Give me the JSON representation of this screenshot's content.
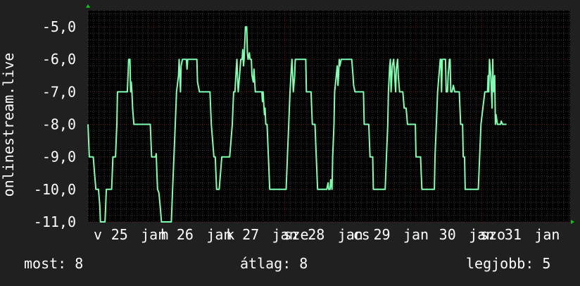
{
  "chart_data": {
    "type": "line",
    "ylabel": "onlinestream.live",
    "ylim": [
      -11,
      -4.5
    ],
    "yticks": [
      {
        "value": -5,
        "label": "-5,0"
      },
      {
        "value": -6,
        "label": "-6,0"
      },
      {
        "value": -7,
        "label": "-7,0"
      },
      {
        "value": -8,
        "label": "-8,0"
      },
      {
        "value": -9,
        "label": "-9,0"
      },
      {
        "value": -10,
        "label": "-10,0"
      },
      {
        "value": -11,
        "label": "-11,0"
      }
    ],
    "xlim": [
      0,
      7.35
    ],
    "xticks": [
      {
        "value": 0.15,
        "label": "v"
      },
      {
        "value": 0.48,
        "label": "25"
      },
      {
        "value": 1.0,
        "label": "jan"
      },
      {
        "value": 1.17,
        "label": "h"
      },
      {
        "value": 1.48,
        "label": "26"
      },
      {
        "value": 2.0,
        "label": "jan"
      },
      {
        "value": 2.17,
        "label": "k"
      },
      {
        "value": 2.48,
        "label": "27"
      },
      {
        "value": 3.0,
        "label": "jan"
      },
      {
        "value": 3.17,
        "label": "sze"
      },
      {
        "value": 3.48,
        "label": "28"
      },
      {
        "value": 4.0,
        "label": "jan"
      },
      {
        "value": 4.17,
        "label": "cs"
      },
      {
        "value": 4.48,
        "label": "29"
      },
      {
        "value": 5.0,
        "label": "jan"
      },
      {
        "value": 5.48,
        "label": "30"
      },
      {
        "value": 6.0,
        "label": "jan"
      },
      {
        "value": 6.17,
        "label": "szo"
      },
      {
        "value": 6.48,
        "label": "31"
      },
      {
        "value": 7.0,
        "label": "jan"
      }
    ],
    "grid": true,
    "series": [
      {
        "color": "#7fffb0",
        "points": [
          [
            0.0,
            -8
          ],
          [
            0.02,
            -9
          ],
          [
            0.08,
            -9
          ],
          [
            0.1,
            -9.5
          ],
          [
            0.12,
            -10
          ],
          [
            0.16,
            -10
          ],
          [
            0.18,
            -10.5
          ],
          [
            0.19,
            -11
          ],
          [
            0.26,
            -11
          ],
          [
            0.28,
            -10
          ],
          [
            0.36,
            -10
          ],
          [
            0.38,
            -9
          ],
          [
            0.42,
            -9
          ],
          [
            0.44,
            -8
          ],
          [
            0.45,
            -7
          ],
          [
            0.6,
            -7
          ],
          [
            0.61,
            -6.5
          ],
          [
            0.62,
            -6
          ],
          [
            0.64,
            -6
          ],
          [
            0.65,
            -7
          ],
          [
            0.66,
            -6.7
          ],
          [
            0.67,
            -7
          ],
          [
            0.68,
            -7.5
          ],
          [
            0.7,
            -8
          ],
          [
            0.95,
            -8
          ],
          [
            0.97,
            -9
          ],
          [
            1.03,
            -9
          ],
          [
            1.04,
            -8.9
          ],
          [
            1.05,
            -9.5
          ],
          [
            1.06,
            -10
          ],
          [
            1.08,
            -10.1
          ],
          [
            1.1,
            -10.5
          ],
          [
            1.12,
            -11
          ],
          [
            1.27,
            -11
          ],
          [
            1.29,
            -10
          ],
          [
            1.31,
            -9
          ],
          [
            1.33,
            -8
          ],
          [
            1.35,
            -7
          ],
          [
            1.38,
            -6.5
          ],
          [
            1.39,
            -6
          ],
          [
            1.41,
            -7
          ],
          [
            1.42,
            -6.2
          ],
          [
            1.44,
            -6
          ],
          [
            1.5,
            -6
          ],
          [
            1.51,
            -6.3
          ],
          [
            1.52,
            -6
          ],
          [
            1.66,
            -6
          ],
          [
            1.67,
            -6.7
          ],
          [
            1.7,
            -7
          ],
          [
            1.86,
            -7
          ],
          [
            1.88,
            -8
          ],
          [
            1.92,
            -9
          ],
          [
            1.94,
            -9
          ],
          [
            1.96,
            -10
          ],
          [
            2.0,
            -10
          ],
          [
            2.02,
            -9.5
          ],
          [
            2.04,
            -9
          ],
          [
            2.16,
            -9
          ],
          [
            2.18,
            -8.5
          ],
          [
            2.2,
            -8
          ],
          [
            2.22,
            -7
          ],
          [
            2.24,
            -7
          ],
          [
            2.26,
            -6.3
          ],
          [
            2.27,
            -6
          ],
          [
            2.28,
            -6.6
          ],
          [
            2.29,
            -7
          ],
          [
            2.31,
            -6.5
          ],
          [
            2.33,
            -6
          ],
          [
            2.35,
            -6
          ],
          [
            2.36,
            -5.7
          ],
          [
            2.37,
            -6.2
          ],
          [
            2.38,
            -6
          ],
          [
            2.39,
            -5.5
          ],
          [
            2.4,
            -5
          ],
          [
            2.42,
            -5
          ],
          [
            2.43,
            -5.8
          ],
          [
            2.44,
            -6
          ],
          [
            2.46,
            -5.8
          ],
          [
            2.47,
            -6
          ],
          [
            2.49,
            -6
          ],
          [
            2.5,
            -6.5
          ],
          [
            2.52,
            -6.7
          ],
          [
            2.53,
            -6.3
          ],
          [
            2.55,
            -7
          ],
          [
            2.65,
            -7
          ],
          [
            2.66,
            -7.3
          ],
          [
            2.67,
            -7
          ],
          [
            2.68,
            -7.4
          ],
          [
            2.69,
            -7.7
          ],
          [
            2.7,
            -7.5
          ],
          [
            2.71,
            -8
          ],
          [
            2.73,
            -8
          ],
          [
            2.75,
            -9
          ],
          [
            2.77,
            -10
          ],
          [
            3.02,
            -10
          ],
          [
            3.04,
            -9
          ],
          [
            3.06,
            -8
          ],
          [
            3.08,
            -7
          ],
          [
            3.1,
            -6.3
          ],
          [
            3.11,
            -6
          ],
          [
            3.12,
            -6.5
          ],
          [
            3.13,
            -7
          ],
          [
            3.15,
            -6.5
          ],
          [
            3.16,
            -6
          ],
          [
            3.32,
            -6
          ],
          [
            3.33,
            -7
          ],
          [
            3.4,
            -7
          ],
          [
            3.41,
            -7.5
          ],
          [
            3.42,
            -8
          ],
          [
            3.46,
            -8
          ],
          [
            3.48,
            -9
          ],
          [
            3.5,
            -10
          ],
          [
            3.64,
            -10
          ],
          [
            3.66,
            -9.8
          ],
          [
            3.67,
            -10
          ],
          [
            3.69,
            -10
          ],
          [
            3.7,
            -9.7
          ],
          [
            3.72,
            -10
          ],
          [
            3.73,
            -9
          ],
          [
            3.75,
            -8
          ],
          [
            3.76,
            -7
          ],
          [
            3.78,
            -6.6
          ],
          [
            3.8,
            -6.2
          ],
          [
            3.81,
            -6.8
          ],
          [
            3.82,
            -6.5
          ],
          [
            3.83,
            -6
          ],
          [
            3.84,
            -6.2
          ],
          [
            3.86,
            -6
          ],
          [
            4.02,
            -6
          ],
          [
            4.04,
            -6.5
          ],
          [
            4.05,
            -6.8
          ],
          [
            4.07,
            -7
          ],
          [
            4.2,
            -7
          ],
          [
            4.21,
            -8
          ],
          [
            4.28,
            -8
          ],
          [
            4.3,
            -9
          ],
          [
            4.34,
            -9
          ],
          [
            4.35,
            -10
          ],
          [
            4.53,
            -10
          ],
          [
            4.55,
            -9
          ],
          [
            4.57,
            -8
          ],
          [
            4.58,
            -7
          ],
          [
            4.6,
            -6.2
          ],
          [
            4.61,
            -6
          ],
          [
            4.62,
            -7
          ],
          [
            4.64,
            -6.2
          ],
          [
            4.66,
            -6
          ],
          [
            4.69,
            -7
          ],
          [
            4.7,
            -6.3
          ],
          [
            4.72,
            -6
          ],
          [
            4.73,
            -6.5
          ],
          [
            4.75,
            -7
          ],
          [
            4.8,
            -7
          ],
          [
            4.82,
            -7.5
          ],
          [
            4.85,
            -7.5
          ],
          [
            4.87,
            -8
          ],
          [
            4.99,
            -8
          ],
          [
            5.0,
            -9
          ],
          [
            5.07,
            -9
          ],
          [
            5.08,
            -9.5
          ],
          [
            5.09,
            -10
          ],
          [
            5.28,
            -10
          ],
          [
            5.29,
            -9
          ],
          [
            5.31,
            -8
          ],
          [
            5.33,
            -7
          ],
          [
            5.35,
            -6.5
          ],
          [
            5.37,
            -6
          ],
          [
            5.38,
            -6
          ],
          [
            5.39,
            -7
          ],
          [
            5.4,
            -6
          ],
          [
            5.45,
            -6
          ],
          [
            5.46,
            -7
          ],
          [
            5.48,
            -7
          ],
          [
            5.49,
            -6.5
          ],
          [
            5.51,
            -6
          ],
          [
            5.52,
            -6
          ],
          [
            5.53,
            -7
          ],
          [
            5.55,
            -7
          ],
          [
            5.57,
            -6.8
          ],
          [
            5.59,
            -7
          ],
          [
            5.66,
            -7
          ],
          [
            5.68,
            -8
          ],
          [
            5.71,
            -8
          ],
          [
            5.72,
            -9
          ],
          [
            5.74,
            -9
          ],
          [
            5.75,
            -10
          ],
          [
            5.95,
            -10
          ],
          [
            5.97,
            -9
          ],
          [
            5.99,
            -8
          ],
          [
            6.02,
            -7.5
          ],
          [
            6.05,
            -7
          ],
          [
            6.09,
            -7
          ],
          [
            6.1,
            -6.5
          ],
          [
            6.11,
            -7
          ],
          [
            6.12,
            -6
          ],
          [
            6.14,
            -6.5
          ],
          [
            6.15,
            -7
          ],
          [
            6.16,
            -7.5
          ],
          [
            6.17,
            -6
          ],
          [
            6.18,
            -7
          ],
          [
            6.2,
            -6.5
          ],
          [
            6.21,
            -8
          ],
          [
            6.22,
            -7.7
          ],
          [
            6.24,
            -8
          ],
          [
            6.29,
            -8
          ],
          [
            6.3,
            -7.9
          ],
          [
            6.32,
            -8
          ],
          [
            6.38,
            -8
          ]
        ]
      }
    ]
  },
  "stats": {
    "most": "most: 8",
    "atlag": "átlag: 8",
    "legjobb": "legjobb: 5"
  },
  "colors": {
    "background": "#202020",
    "plot_background": "#000000",
    "grid": "#3a3a3a",
    "grid_major": "#5a2020",
    "line": "#7fffb0",
    "axis_arrow": "#00cc00"
  }
}
